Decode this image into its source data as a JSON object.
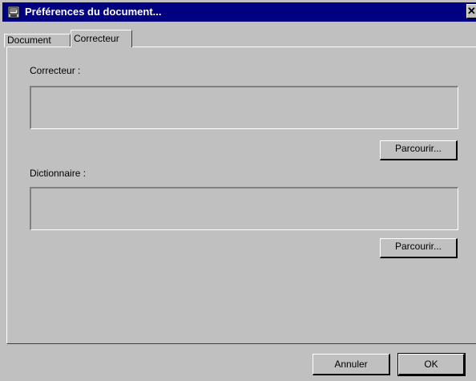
{
  "window": {
    "title": "Préférences du document...",
    "close_glyph": "✕"
  },
  "tabs": [
    {
      "label": "Document",
      "active": false
    },
    {
      "label": "Correcteur",
      "active": true
    }
  ],
  "correcteur": {
    "label": "Correcteur :",
    "value": "",
    "browse_label": "Parcourir..."
  },
  "dictionnaire": {
    "label": "Dictionnaire :",
    "value": "",
    "browse_label": "Parcourir..."
  },
  "footer": {
    "cancel_label": "Annuler",
    "ok_label": "OK"
  },
  "colors": {
    "titlebar": "#000080",
    "face": "#c0c0c0"
  },
  "icons": {
    "title": "document-window-icon",
    "close": "close-icon"
  }
}
